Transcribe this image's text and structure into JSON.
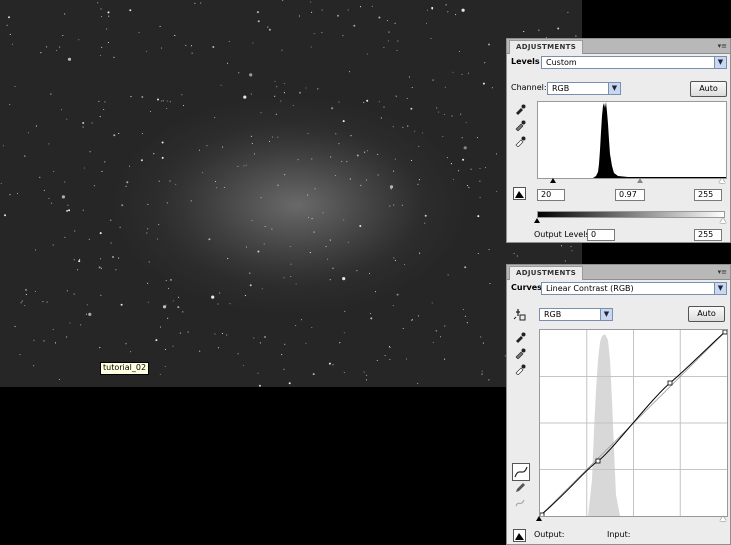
{
  "image_tooltip": "tutorial_02",
  "levels_panel": {
    "tab_label": "ADJUSTMENTS",
    "menu_glyph": "▾≡",
    "title": "Levels",
    "preset_value": "Custom",
    "channel_label": "Channel:",
    "channel_value": "RGB",
    "auto_label": "Auto",
    "input_black": "20",
    "input_gamma": "0.97",
    "input_white": "255",
    "output_label": "Output Levels:",
    "output_black": "0",
    "output_white": "255"
  },
  "curves_panel": {
    "tab_label": "ADJUSTMENTS",
    "menu_glyph": "▾≡",
    "title": "Curves",
    "preset_value": "Linear Contrast (RGB)",
    "channel_value": "RGB",
    "auto_label": "Auto",
    "output_label": "Output:",
    "input_label": "Input:"
  },
  "icons": {
    "black_eyedropper": "eyedropper-black-icon",
    "gray_eyedropper": "eyedropper-gray-icon",
    "white_eyedropper": "eyedropper-white-icon",
    "clip_warning": "clipping-warning-icon",
    "on_image_adjust": "targeted-adjustment-icon",
    "curve_tool": "curve-point-icon",
    "pencil_tool": "pencil-icon",
    "smooth_tool": "smooth-curve-icon"
  },
  "colors": {
    "panel_bg": "#ececec",
    "select_border": "#7a8fb0",
    "tooltip_bg": "#ffffe1"
  }
}
